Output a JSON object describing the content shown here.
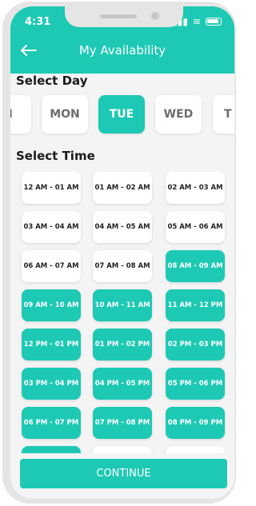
{
  "status_bar": {
    "time": "4:31"
  },
  "header": {
    "title": "My Availability",
    "back_icon": "arrow-left-icon"
  },
  "select_day": {
    "title": "Select Day",
    "days": [
      {
        "label": "N",
        "selected": false
      },
      {
        "label": "MON",
        "selected": false
      },
      {
        "label": "TUE",
        "selected": true
      },
      {
        "label": "WED",
        "selected": false
      },
      {
        "label": "T",
        "selected": false
      }
    ]
  },
  "select_time": {
    "title": "Select Time",
    "slots": [
      {
        "label": "12 AM - 01 AM",
        "selected": false
      },
      {
        "label": "01 AM - 02 AM",
        "selected": false
      },
      {
        "label": "02 AM - 03 AM",
        "selected": false
      },
      {
        "label": "03 AM - 04 AM",
        "selected": false
      },
      {
        "label": "04 AM - 05 AM",
        "selected": false
      },
      {
        "label": "05 AM - 06 AM",
        "selected": false
      },
      {
        "label": "06 AM - 07 AM",
        "selected": false
      },
      {
        "label": "07 AM - 08 AM",
        "selected": false
      },
      {
        "label": "08 AM - 09 AM",
        "selected": true
      },
      {
        "label": "09 AM - 10 AM",
        "selected": true
      },
      {
        "label": "10 AM - 11 AM",
        "selected": true
      },
      {
        "label": "11 AM - 12 PM",
        "selected": true
      },
      {
        "label": "12 PM - 01 PM",
        "selected": true
      },
      {
        "label": "01 PM - 02 PM",
        "selected": true
      },
      {
        "label": "02 PM - 03 PM",
        "selected": true
      },
      {
        "label": "03 PM - 04 PM",
        "selected": true
      },
      {
        "label": "04 PM - 05 PM",
        "selected": true
      },
      {
        "label": "05 PM - 06 PM",
        "selected": true
      },
      {
        "label": "06 PM - 07 PM",
        "selected": true
      },
      {
        "label": "07 PM - 08 PM",
        "selected": true
      },
      {
        "label": "08 PM - 09 PM",
        "selected": true
      },
      {
        "label": "",
        "selected": true
      },
      {
        "label": "",
        "selected": false
      },
      {
        "label": "",
        "selected": false
      }
    ]
  },
  "footer": {
    "continue_label": "CONTINUE"
  },
  "colors": {
    "accent": "#1dc9b4",
    "background": "#f4f4f4",
    "card": "#ffffff",
    "text_dark": "#1b1b1b",
    "text_muted": "#6c6c6c"
  }
}
